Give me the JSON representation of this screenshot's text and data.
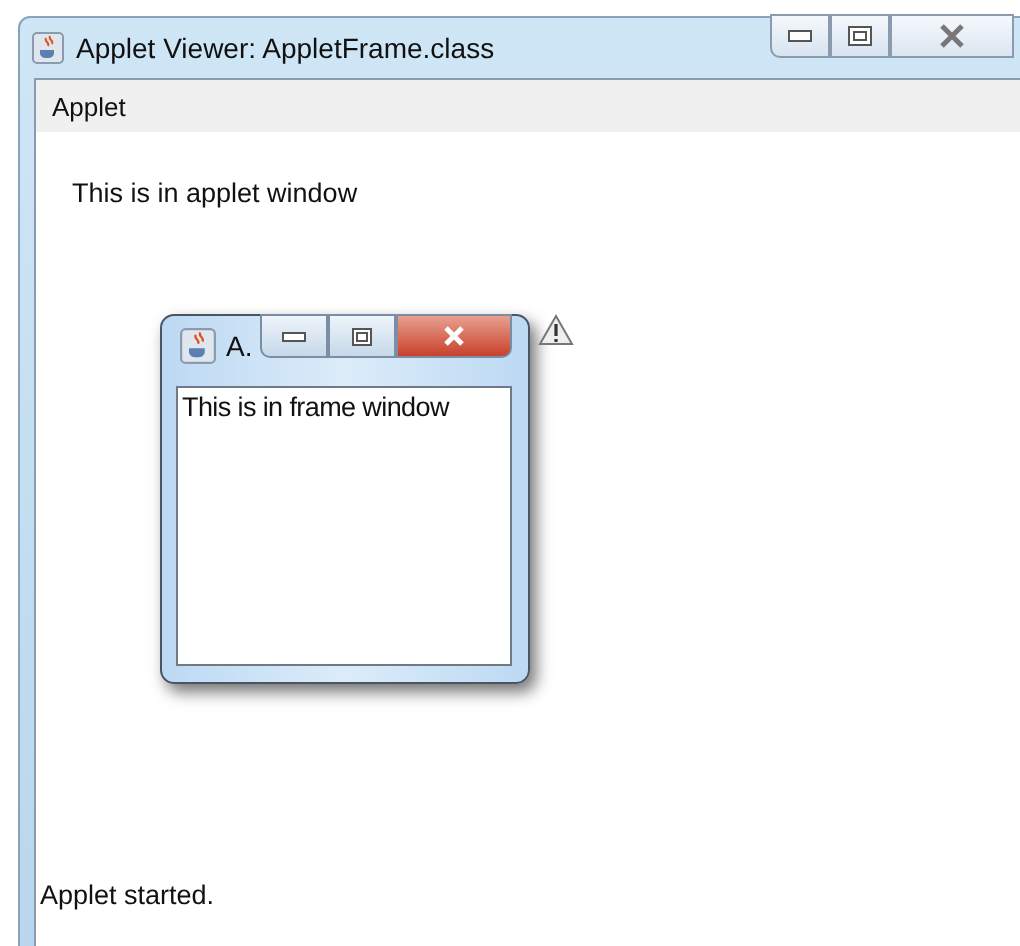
{
  "window": {
    "title": "Applet Viewer: AppletFrame.class"
  },
  "menu": [
    "Applet"
  ],
  "applet": {
    "text": "This is in applet window"
  },
  "frame": {
    "title": "A.",
    "text": "This is in frame window"
  },
  "status_bar": "Applet started."
}
